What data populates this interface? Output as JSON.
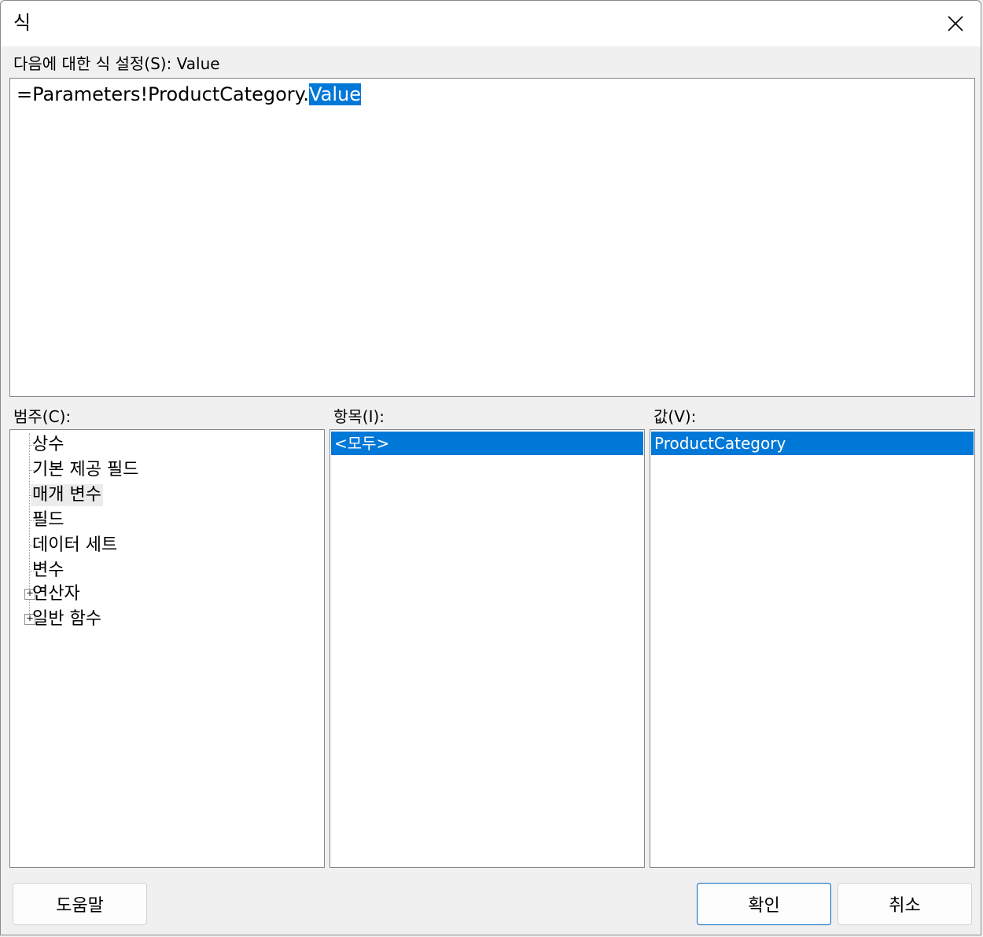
{
  "window": {
    "title": "식",
    "close_icon": "close-icon"
  },
  "expression": {
    "label": "다음에 대한 식 설정(S): Value",
    "text_prefix": "=Parameters!ProductCategory.",
    "text_selected": "Value"
  },
  "category": {
    "label": "범주(C):",
    "items": [
      {
        "label": "상수",
        "expandable": false
      },
      {
        "label": "기본 제공 필드",
        "expandable": false
      },
      {
        "label": "매개 변수",
        "expandable": false,
        "current": true
      },
      {
        "label": "필드",
        "expandable": false
      },
      {
        "label": "데이터 세트",
        "expandable": false
      },
      {
        "label": "변수",
        "expandable": false
      },
      {
        "label": "연산자",
        "expandable": true,
        "expander": "+"
      },
      {
        "label": "일반 함수",
        "expandable": true,
        "expander": "+"
      }
    ]
  },
  "item": {
    "label": "항목(I):",
    "items": [
      {
        "label": "<모두>",
        "selected": true
      }
    ]
  },
  "value": {
    "label": "값(V):",
    "items": [
      {
        "label": "ProductCategory",
        "selected": true
      }
    ]
  },
  "buttons": {
    "help": "도움말",
    "ok": "확인",
    "cancel": "취소"
  },
  "colors": {
    "selection": "#0078d7",
    "window_bg": "#f0f0f0"
  }
}
